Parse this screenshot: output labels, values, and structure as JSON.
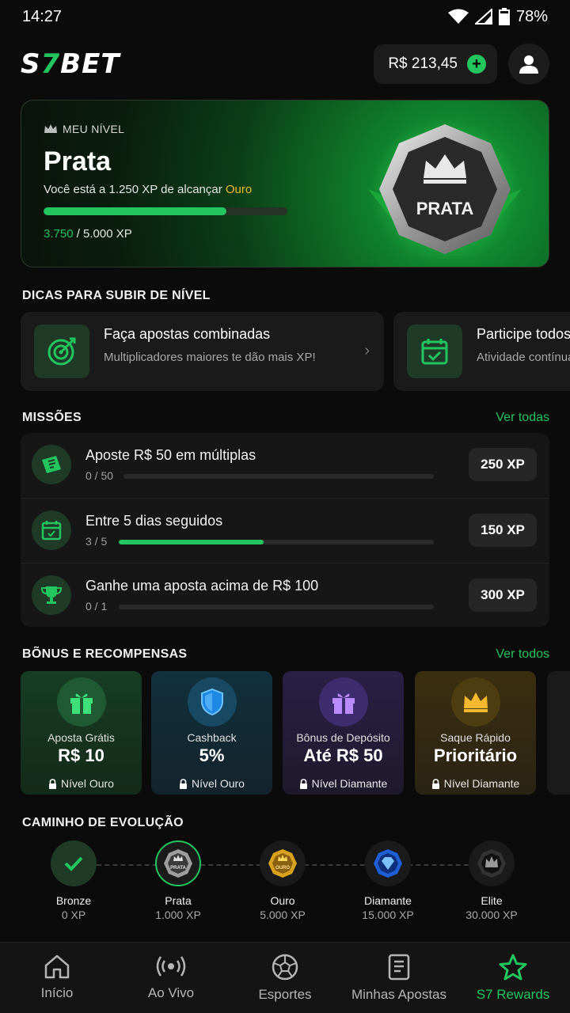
{
  "status_bar": {
    "time": "14:27",
    "battery": "78%"
  },
  "header": {
    "logo_prefix": "S",
    "logo_seven": "7",
    "logo_suffix": "BET",
    "balance": "R$ 213,45",
    "add_symbol": "+"
  },
  "level": {
    "tag": "MEU NÍVEL",
    "name": "Prata",
    "sub_prefix": "Você está a 1.250 XP de alcançar ",
    "next_level": "Ouro",
    "progress": 0.75,
    "xp_current": "3.750",
    "xp_total": " / 5.000 XP",
    "badge_label": "PRATA"
  },
  "tips": {
    "title": "DICAS PARA SUBIR DE NÍVEL",
    "items": [
      {
        "title": "Faça apostas combinadas",
        "desc": "Multiplicadores maiores te dão mais XP!",
        "icon": "target-icon"
      },
      {
        "title": "Participe todos os dias",
        "desc": "Atividade contínua gera recompensas",
        "icon": "calendar-check-icon"
      }
    ]
  },
  "missions": {
    "title": "MISSÕES",
    "see_all": "Ver todas",
    "items": [
      {
        "title": "Aposte R$ 50 em múltiplas",
        "count": "0 / 50",
        "progress": 0.0,
        "xp": "250 XP",
        "icon": "ticket-icon"
      },
      {
        "title": "Entre 5 dias seguidos",
        "count": "3 / 5",
        "progress": 0.46,
        "xp": "150 XP",
        "icon": "calendar-icon"
      },
      {
        "title": "Ganhe uma aposta acima de R$ 100",
        "count": "0 / 1",
        "progress": 0.0,
        "xp": "300 XP",
        "icon": "trophy-icon"
      }
    ]
  },
  "bonus": {
    "title": "BÕNUS E RECOMPENSAS",
    "see_all": "Ver todos",
    "items": [
      {
        "label": "Aposta Grátis",
        "value": "R$ 10",
        "lock": "Nível Ouro",
        "icon": "gift-icon",
        "color": "#22c55e"
      },
      {
        "label": "Cashback",
        "value": "5%",
        "lock": "Nível Ouro",
        "icon": "shield-icon",
        "color": "#1e88e5"
      },
      {
        "label": "Bônus de Depósito",
        "value": "Até R$ 50",
        "lock": "Nível Diamante",
        "icon": "gift-icon",
        "color": "#8b5cf6"
      },
      {
        "label": "Saque Rápido",
        "value": "Prioritário",
        "lock": "Nível Diamante",
        "icon": "crown-icon",
        "color": "#f5b82e"
      }
    ]
  },
  "evolution": {
    "title": "CAMINHO DE EVOLUÇÃO",
    "levels": [
      {
        "name": "Bronze",
        "xp": "0 XP"
      },
      {
        "name": "Prata",
        "xp": "1.000 XP",
        "emblem": "PRATA"
      },
      {
        "name": "Ouro",
        "xp": "5.000 XP",
        "emblem": "OURO"
      },
      {
        "name": "Diamante",
        "xp": "15.000 XP"
      },
      {
        "name": "Elite",
        "xp": "30.000 XP"
      }
    ]
  },
  "nav": {
    "items": [
      {
        "label": "Início",
        "icon": "home-icon"
      },
      {
        "label": "Ao Vivo",
        "icon": "live-icon"
      },
      {
        "label": "Esportes",
        "icon": "soccer-ball-icon"
      },
      {
        "label": "Minhas Apostas",
        "icon": "receipt-icon"
      },
      {
        "label": "S7 Rewards",
        "icon": "star-icon",
        "active": true
      }
    ]
  }
}
